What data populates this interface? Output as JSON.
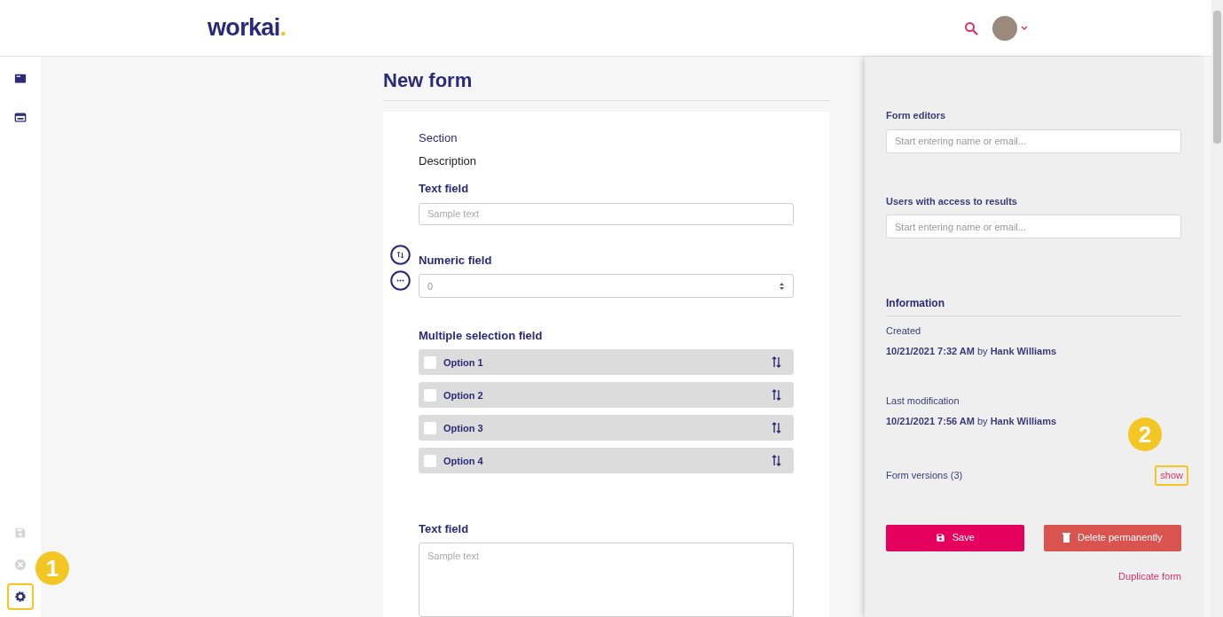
{
  "header": {
    "logo": "workai",
    "logo_dot": "."
  },
  "sidebar": {
    "top_items": [
      {
        "kind": "card"
      },
      {
        "kind": "window"
      }
    ],
    "bottom_items": [
      {
        "kind": "save",
        "disabled": true,
        "highlighted": false
      },
      {
        "kind": "cancel",
        "disabled": true,
        "highlighted": false
      },
      {
        "kind": "settings",
        "disabled": false,
        "highlighted": true
      }
    ]
  },
  "callouts": [
    "1",
    "2"
  ],
  "form": {
    "title": "New form",
    "fields": [
      {
        "kind": "section",
        "label": "Section",
        "description": "Description"
      },
      {
        "kind": "text",
        "label": "Text field",
        "placeholder": "Sample text"
      },
      {
        "kind": "number",
        "label": "Numeric field",
        "placeholder": "0"
      },
      {
        "kind": "multi",
        "label": "Multiple selection field",
        "options": [
          {
            "label": "Option 1",
            "checked": false
          },
          {
            "label": "Option 2",
            "checked": false
          },
          {
            "label": "Option 3",
            "checked": false
          },
          {
            "label": "Option 4",
            "checked": false
          }
        ]
      },
      {
        "kind": "textarea",
        "label": "Text field",
        "placeholder": "Sample text"
      }
    ]
  },
  "panel": {
    "editors": {
      "label": "Form editors",
      "placeholder": "Start entering name or email..."
    },
    "access": {
      "label": "Users with access to results",
      "placeholder": "Start entering name or email..."
    },
    "information": {
      "title": "Information",
      "created_label": "Created",
      "created": "**10/21/2021 7:32 AM** by **Hank Williams**",
      "modified_label": "Last modification",
      "modified": "**10/21/2021 7:56 AM** by **Hank Williams**",
      "versions": "Form versions (3)",
      "show": "show",
      "show_highlighted": true
    },
    "save": "Save",
    "delete": "Delete permanently",
    "duplicate": "Duplicate form"
  }
}
